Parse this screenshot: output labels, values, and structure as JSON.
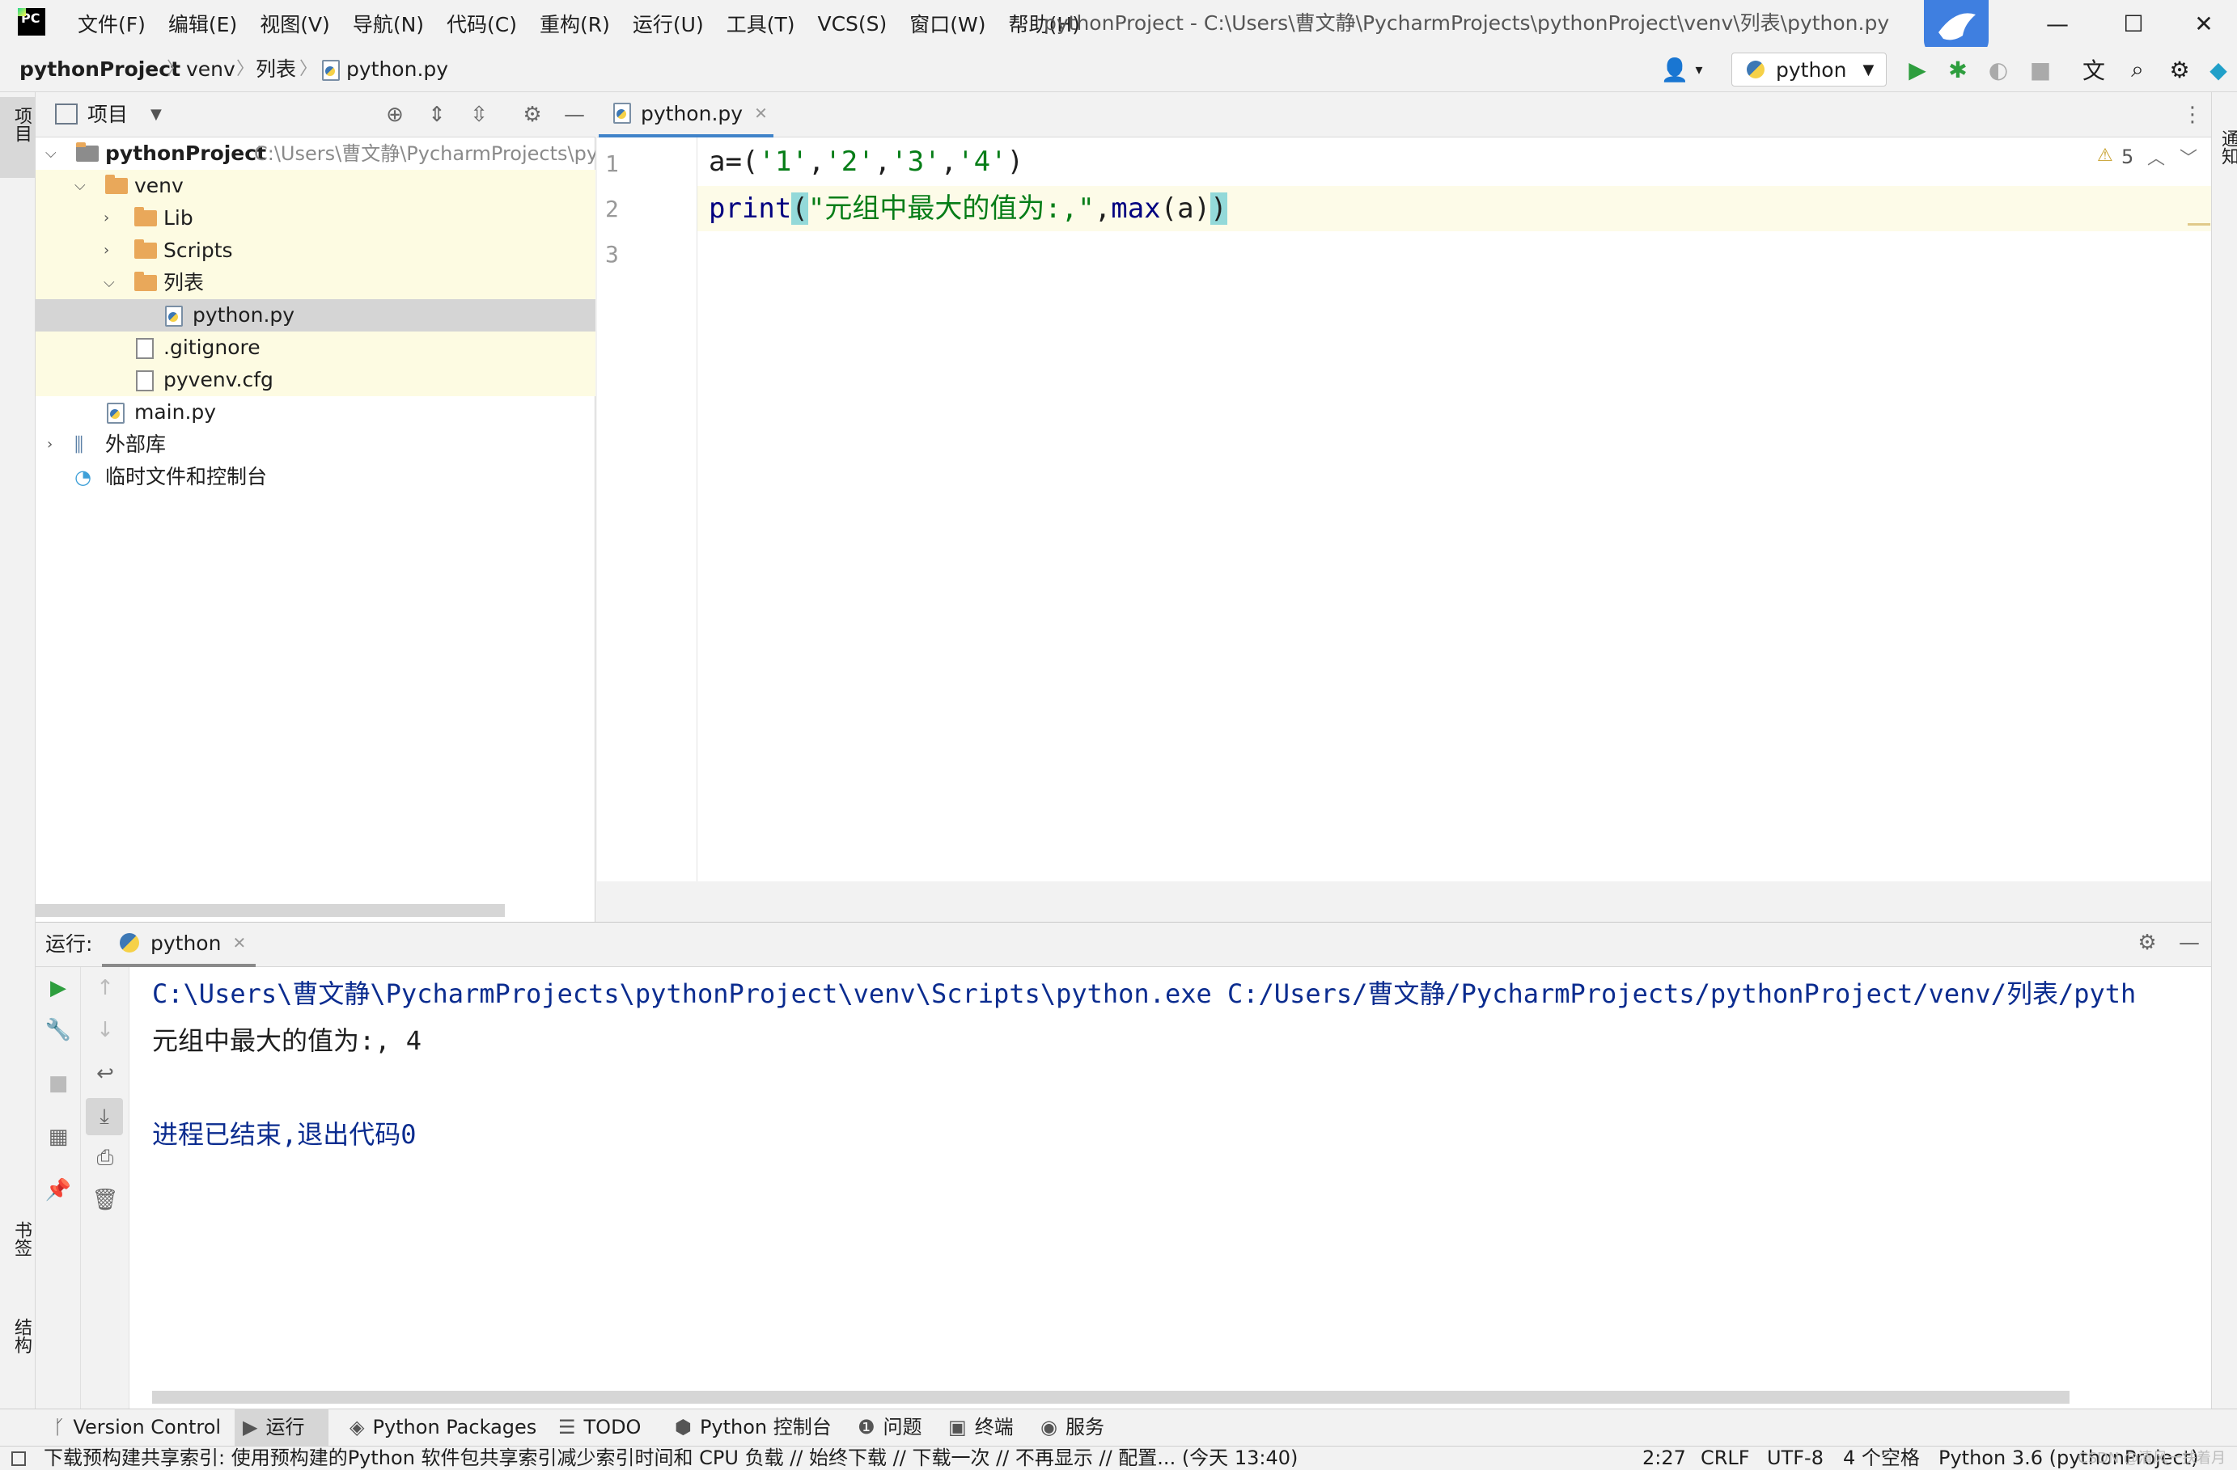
{
  "menu": [
    "文件(F)",
    "编辑(E)",
    "视图(V)",
    "导航(N)",
    "代码(C)",
    "重构(R)",
    "运行(U)",
    "工具(T)",
    "VCS(S)",
    "窗口(W)",
    "帮助(H)"
  ],
  "window_title": "pythonProject - C:\\Users\\曹文静\\PycharmProjects\\pythonProject\\venv\\列表\\python.py",
  "breadcrumb": [
    "pythonProject",
    "venv",
    "列表",
    "python.py"
  ],
  "run_config": "python",
  "left_stripe": {
    "project": "项目",
    "bookmarks": "书签",
    "structure": "结构"
  },
  "right_stripe": {
    "notifications": "通知"
  },
  "project_panel": {
    "title": "项目",
    "tree": [
      {
        "label": "pythonProject",
        "path": "C:\\Users\\曹文静\\PycharmProjects\\pyt"
      },
      {
        "label": "venv"
      },
      {
        "label": "Lib"
      },
      {
        "label": "Scripts"
      },
      {
        "label": "列表"
      },
      {
        "label": "python.py"
      },
      {
        "label": ".gitignore"
      },
      {
        "label": "pyvenv.cfg"
      },
      {
        "label": "main.py"
      },
      {
        "label": "外部库"
      },
      {
        "label": "临时文件和控制台"
      }
    ]
  },
  "editor": {
    "tab": "python.py",
    "line_numbers": [
      "1",
      "2",
      "3"
    ],
    "warnings": "5",
    "code": {
      "l1_a": "a=(",
      "l1_s1": "'1'",
      "l1_s2": "'2'",
      "l1_s3": "'3'",
      "l1_s4": "'4'",
      "comma": ",",
      "close": ")",
      "l2_print": "print",
      "l2_open": "(",
      "l2_str": "\"元组中最大的值为:,\"",
      "l2_comma": ",",
      "l2_max": "max",
      "l2_args": "(a)",
      "l2_close": ")"
    }
  },
  "run_panel": {
    "label": "运行:",
    "tab": "python",
    "output": [
      "C:\\Users\\曹文静\\PycharmProjects\\pythonProject\\venv\\Scripts\\python.exe C:/Users/曹文静/PycharmProjects/pythonProject/venv/列表/pyth",
      "元组中最大的值为:, 4",
      "",
      "进程已结束,退出代码0"
    ]
  },
  "bottom_tabs": [
    "Version Control",
    "运行",
    "Python Packages",
    "TODO",
    "Python 控制台",
    "问题",
    "终端",
    "服务"
  ],
  "status": {
    "message": "下载预构建共享索引: 使用预构建的Python 软件包共享索引减少索引时间和 CPU 负载 // 始终下载 // 下载一次 // 不再显示 // 配置... (今天 13:40)",
    "position": "2:27",
    "line_sep": "CRLF",
    "encoding": "UTF-8",
    "indent": "4 个空格",
    "interpreter": "Python 3.6 (pythonProject)",
    "watermark": "CSDN @清风一扶着月"
  },
  "colors": {
    "accent": "#4083c9",
    "string": "#067d17",
    "builtin": "#000080",
    "folder": "#e9a85a",
    "output_path": "#0b2c8f"
  }
}
